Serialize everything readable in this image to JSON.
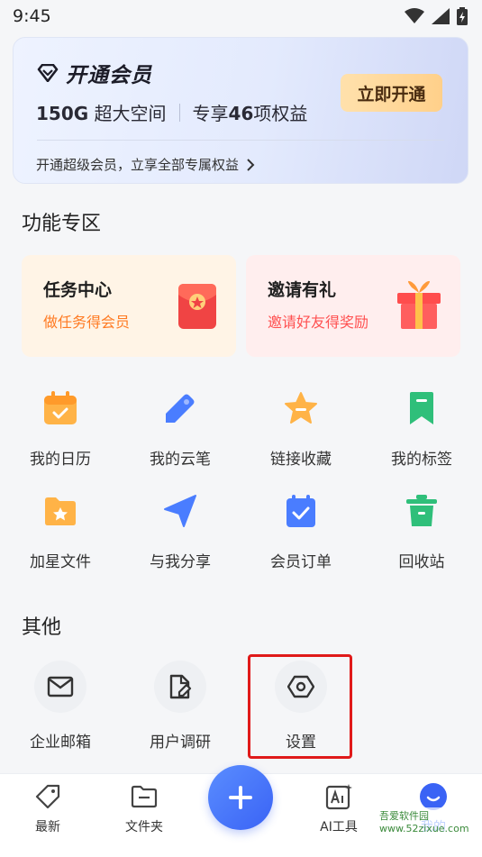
{
  "status_bar": {
    "time": "9:45"
  },
  "vip": {
    "title": "开通会员",
    "feature1_amount": "150G",
    "feature1_text": " 超大空间",
    "feature2_prefix": "专享",
    "feature2_amount": "46",
    "feature2_suffix": "项权益",
    "open_label": "立即开通",
    "link_text": "开通超级会员，立享全部专属权益"
  },
  "features_section": {
    "title": "功能专区"
  },
  "promo": {
    "task": {
      "title": "任务中心",
      "subtitle": "做任务得会员"
    },
    "invite": {
      "title": "邀请有礼",
      "subtitle": "邀请好友得奖励"
    }
  },
  "grid": [
    {
      "label": "我的日历",
      "icon": "calendar-icon"
    },
    {
      "label": "我的云笔",
      "icon": "pen-icon"
    },
    {
      "label": "链接收藏",
      "icon": "star-icon"
    },
    {
      "label": "我的标签",
      "icon": "bookmark-icon"
    },
    {
      "label": "加星文件",
      "icon": "star-folder-icon"
    },
    {
      "label": "与我分享",
      "icon": "share-icon"
    },
    {
      "label": "会员订单",
      "icon": "order-icon"
    },
    {
      "label": "回收站",
      "icon": "trash-icon"
    }
  ],
  "others_section": {
    "title": "其他"
  },
  "others": [
    {
      "label": "企业邮箱",
      "icon": "mail-icon"
    },
    {
      "label": "用户调研",
      "icon": "survey-icon"
    },
    {
      "label": "设置",
      "icon": "settings-icon"
    }
  ],
  "bottom_nav": [
    {
      "label": "最新",
      "icon": "tag-icon"
    },
    {
      "label": "文件夹",
      "icon": "folder-icon"
    },
    {
      "label": "AI工具",
      "icon": "ai-icon"
    },
    {
      "label": "我的",
      "icon": "profile-icon"
    }
  ],
  "watermark": "吾爱软件园 www.52zixue.com",
  "colors": {
    "accent": "#2f6bff",
    "orange": "#ff7a22",
    "red": "#ff5050",
    "green": "#2fbf7a",
    "highlight": "#e01a1a"
  }
}
